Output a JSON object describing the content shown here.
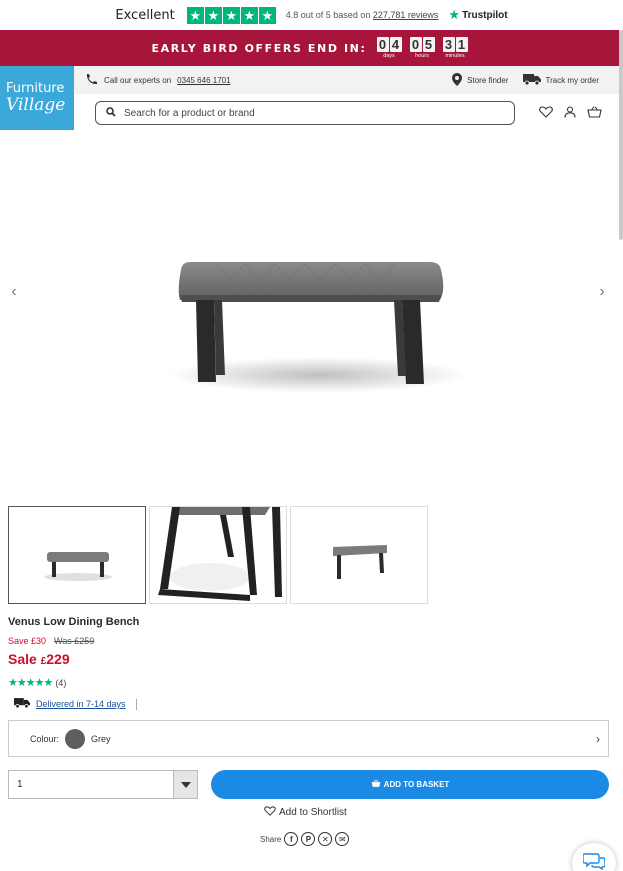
{
  "colors": {
    "promo_bg": "#a7163a",
    "logo_bg": "#3aa9d9",
    "sale_red": "#c8102e",
    "basket_blue": "#1a8ae5",
    "trustpilot_green": "#00b67a"
  },
  "trustpilot": {
    "excellent": "Excellent",
    "stars": 5,
    "rating_prefix": "4.8 out of 5 based on",
    "reviews_link": "227,781 reviews",
    "brand": "Trustpilot"
  },
  "promo": {
    "text": "EARLY BIRD OFFERS END IN:",
    "countdown": [
      {
        "digits": [
          "0",
          "4"
        ],
        "label": "days"
      },
      {
        "digits": [
          "0",
          "5"
        ],
        "label": "hours"
      },
      {
        "digits": [
          "3",
          "1"
        ],
        "label": "minutes"
      }
    ]
  },
  "header": {
    "logo_line1": "Furniture",
    "logo_line2": "Village",
    "call_text": "Call our experts on",
    "phone": "0345 646 1701",
    "store_finder": "Store finder",
    "track_order": "Track my order",
    "search_placeholder": "Search for a product or brand"
  },
  "product": {
    "title": "Venus Low Dining Bench",
    "save": "Save £30",
    "was": "Was £259",
    "sale_label": "Sale",
    "currency": "£",
    "price": "229",
    "rating_stars": 5,
    "review_count": "(4)",
    "delivery": "Delivered in 7-14 days",
    "colour_label": "Colour:",
    "colour_value": "Grey",
    "colour_swatch": "#5e5e5e",
    "quantity": "1",
    "add_to_basket": "ADD TO BASKET",
    "shortlist": "Add to Shortlist",
    "share_label": "Share"
  }
}
